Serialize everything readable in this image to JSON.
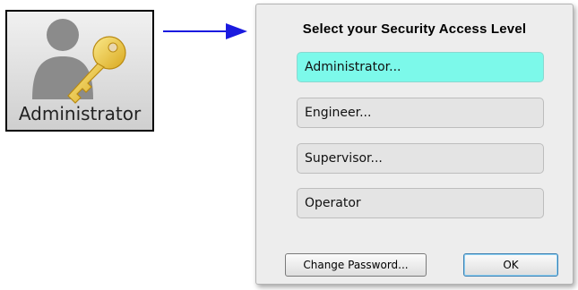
{
  "tile": {
    "label": "Administrator",
    "icon": "user-key-icon"
  },
  "arrow": {
    "icon": "right-arrow-icon",
    "color": "#1a1adf"
  },
  "dialog": {
    "title": "Select your Security Access Level",
    "levels": [
      {
        "label": "Administrator...",
        "selected": true
      },
      {
        "label": "Engineer...",
        "selected": false
      },
      {
        "label": "Supervisor...",
        "selected": false
      },
      {
        "label": "Operator",
        "selected": false
      }
    ],
    "change_password_label": "Change Password...",
    "ok_label": "OK"
  },
  "colors": {
    "selected_level": "#7cf9ea",
    "dialog_background": "#ededed"
  }
}
